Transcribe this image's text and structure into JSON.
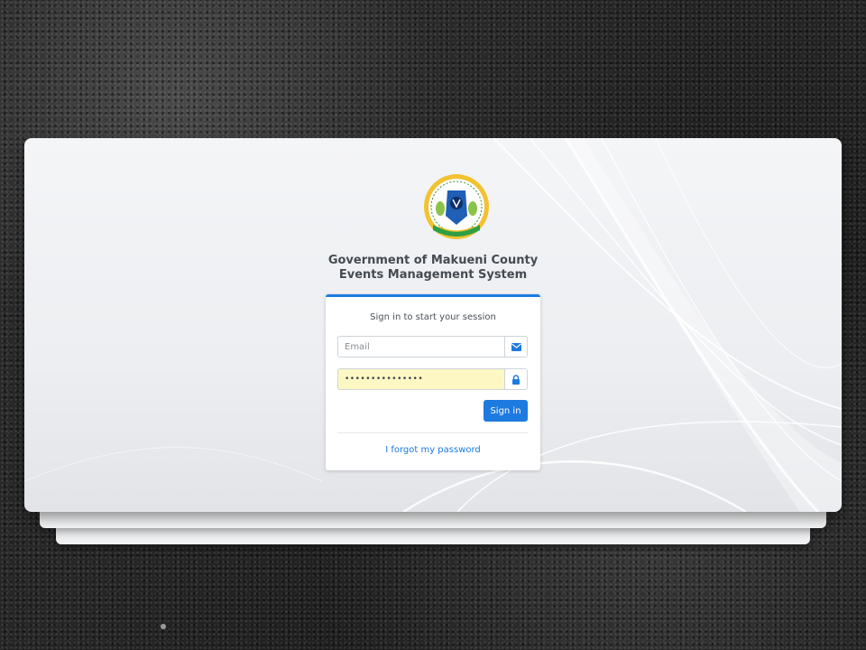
{
  "organization": {
    "name_line1": "Government of Makueni County",
    "name_line2": "Events Management System",
    "logo_icon": "county-coat-of-arms-icon"
  },
  "login": {
    "message": "Sign in to start your session",
    "email": {
      "placeholder": "Email",
      "value": "",
      "icon": "envelope-icon"
    },
    "password": {
      "masked_value": "•••••••••••••••",
      "icon": "lock-icon"
    },
    "signin_label": "Sign in",
    "forgot_label": "I forgot my password"
  },
  "colors": {
    "primary": "#1d7ae0",
    "autofill": "#fdf7c4",
    "title_text": "#454b52"
  }
}
